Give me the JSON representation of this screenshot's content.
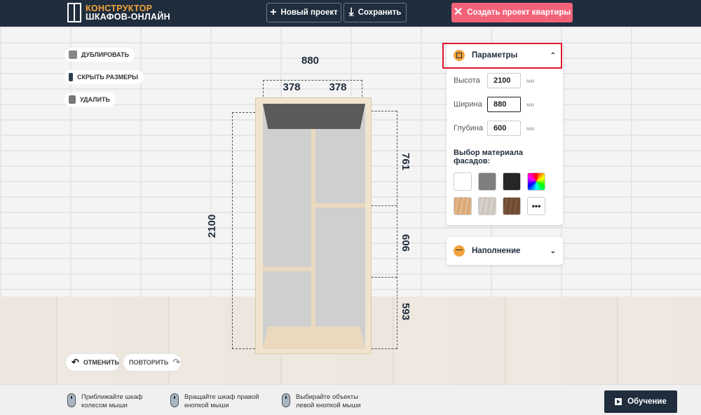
{
  "header": {
    "logo_line1": "КОНСТРУКТОР",
    "logo_line2": "ШКАФОВ-ОНЛАЙН",
    "new_project_label": "Новый проект",
    "save_label": "Сохранить",
    "create_apartment_label": "Создать проект квартиры",
    "create_button_color": "#f2637a"
  },
  "actions": {
    "duplicate_label": "ДУБЛИРОВАТЬ",
    "hide_sizes_label": "СКРЫТЬ РАЗМЕРЫ",
    "delete_label": "УДАЛИТЬ",
    "undo_label": "ОТМЕНИТЬ",
    "redo_label": "ПОВТОРИТЬ"
  },
  "wardrobe": {
    "total_width": "880",
    "section_left_width": "378",
    "section_right_width": "378",
    "total_height": "2100",
    "section_heights": [
      "761",
      "606",
      "593"
    ]
  },
  "parameters": {
    "title": "Параметры",
    "fields": [
      {
        "label": "Высота",
        "value": "2100",
        "unit": "мм"
      },
      {
        "label": "Ширина",
        "value": "880",
        "unit": "мм"
      },
      {
        "label": "Глубина",
        "value": "600",
        "unit": "мм"
      }
    ],
    "material_title": "Выбор материала фасадов:",
    "swatches": [
      {
        "name": "white",
        "color": "#ffffff"
      },
      {
        "name": "gray",
        "color": "#7f7f7f"
      },
      {
        "name": "black",
        "color": "#262626"
      },
      {
        "name": "rainbow",
        "color": "gradient"
      },
      {
        "name": "light-wood",
        "color": "#d8a977"
      },
      {
        "name": "gray-wood",
        "color": "#cbc5bd"
      },
      {
        "name": "dark-wood",
        "color": "#6e4a32"
      },
      {
        "name": "more",
        "label": "•••"
      }
    ]
  },
  "filling": {
    "title": "Наполнение"
  },
  "footer": {
    "tip1": [
      "Приближайте шкаф",
      "колесом мыши"
    ],
    "tip2": [
      "Вращайте шкаф правой",
      "кнопкой мыши"
    ],
    "tip3": [
      "Выбирайте объекты",
      "левой кнопкой мыши"
    ],
    "learn_label": "Обучение"
  }
}
